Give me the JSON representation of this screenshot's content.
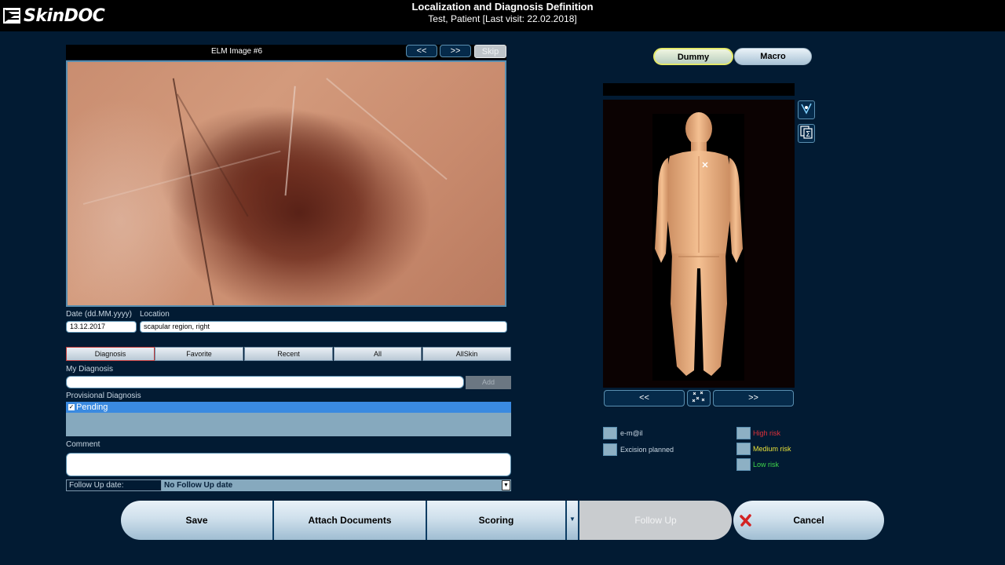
{
  "app": {
    "name": "SkinDOC"
  },
  "header": {
    "title": "Localization and Diagnosis Definition",
    "subtitle": "Test, Patient [Last visit: 22.02.2018]"
  },
  "image_panel": {
    "title": "ELM Image #6",
    "prev_label": "<<",
    "next_label": ">>",
    "skip_label": "Skip"
  },
  "fields": {
    "date_label": "Date (dd.MM.yyyy)",
    "date_value": "13.12.2017",
    "location_label": "Location",
    "location_value": "scapular region, right"
  },
  "diag_tabs": [
    {
      "label": "Diagnosis"
    },
    {
      "label": "Favorite"
    },
    {
      "label": "Recent"
    },
    {
      "label": "All"
    },
    {
      "label": "AllSkin"
    }
  ],
  "my_diagnosis": {
    "label": "My Diagnosis",
    "value": "",
    "add_label": "Add"
  },
  "provisional": {
    "label": "Provisional Diagnosis",
    "items": [
      {
        "label": "Pending",
        "checked": true
      }
    ]
  },
  "comment": {
    "label": "Comment",
    "value": ""
  },
  "follow_up": {
    "label": "Follow Up date:",
    "selected": "No Follow Up date"
  },
  "bottom_buttons": {
    "save": "Save",
    "attach": "Attach Documents",
    "scoring": "Scoring",
    "follow_up": "Follow Up",
    "cancel": "Cancel"
  },
  "view_toggle": {
    "dummy": "Dummy",
    "macro": "Macro"
  },
  "dummy_nav": {
    "prev": "<<",
    "next": ">>"
  },
  "flags": {
    "email": "e-m@il",
    "excision": "Excision planned",
    "high": "High risk",
    "medium": "Medium risk",
    "low": "Low risk"
  },
  "colors": {
    "background": "#021b33",
    "high_risk": "#e0313a",
    "medium_risk": "#e8e23a",
    "low_risk": "#3fd64a",
    "selection": "#3a8ae0"
  },
  "icons": [
    "skindoc-logo-icon",
    "marker-pen-icon",
    "sum-document-icon",
    "dropdown-arrow-icon",
    "scatter-points-icon",
    "cancel-x-icon",
    "lesion-marker-icon"
  ]
}
